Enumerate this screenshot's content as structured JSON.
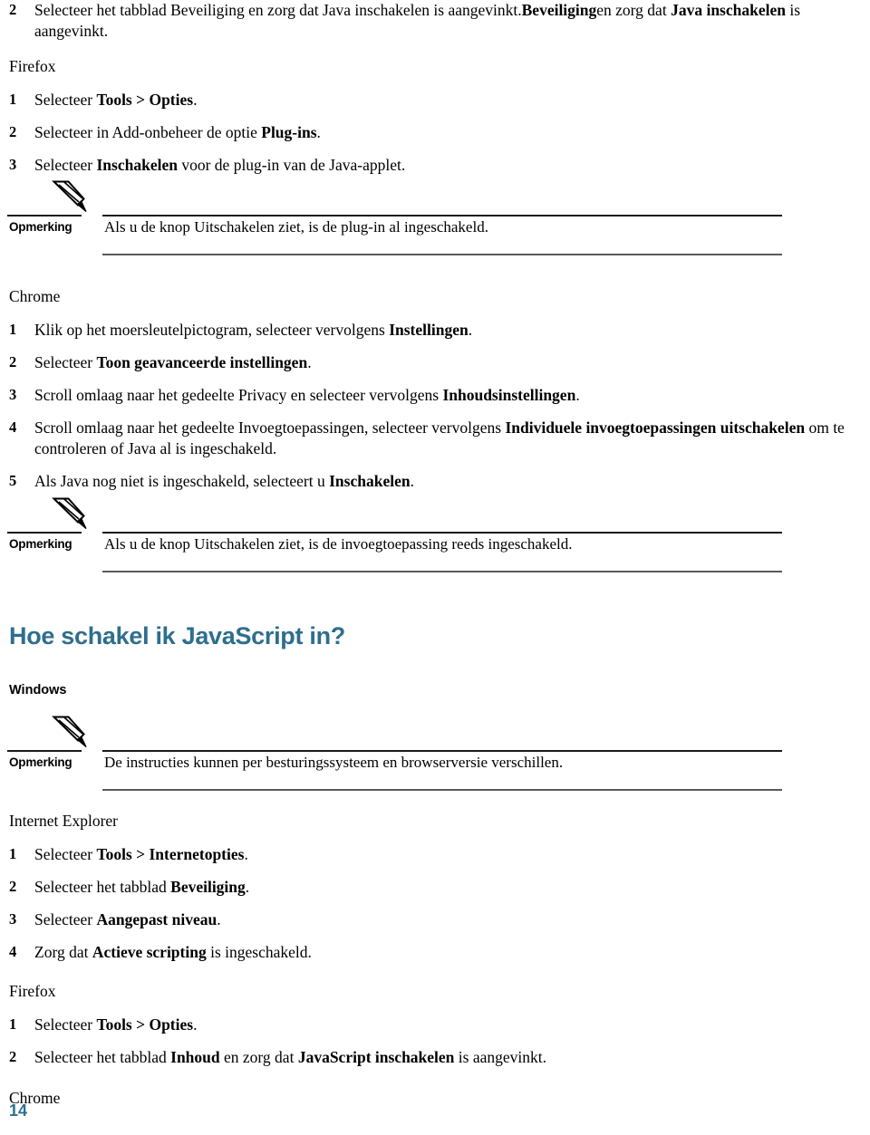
{
  "theme": {
    "accent_blue": "#2E6E8E",
    "rule_dark": "#1a1a1a",
    "rule_gray": "#595959",
    "text": "#000000"
  },
  "top_step": {
    "number": "2",
    "text_plain_1": "Selecteer het tabblad Beveiliging en zorg dat Java inschakelen is aangevinkt.",
    "text_bold_1": "Beveiliging",
    "text_plain_2": "en zorg dat ",
    "text_bold_2": "Java inschakelen",
    "text_plain_3": " is aangevinkt."
  },
  "sections": {
    "firefox_java": {
      "heading": "Firefox",
      "steps": [
        {
          "number": "1",
          "plain_1": "Selecteer ",
          "bold": "Tools > Opties",
          "plain_2": "."
        },
        {
          "number": "2",
          "plain_1": "Selecteer in Add-onbeheer de optie ",
          "bold": "Plug-ins",
          "plain_2": "."
        },
        {
          "number": "3",
          "plain_1": "Selecteer ",
          "bold": "Inschakelen",
          "plain_2": " voor de plug-in van de Java-applet."
        }
      ]
    },
    "chrome_java": {
      "heading": "Chrome",
      "steps": [
        {
          "number": "1",
          "plain_1": "Klik op het moersleutelpictogram, selecteer vervolgens ",
          "bold": "Instellingen",
          "plain_2": "."
        },
        {
          "number": "2",
          "plain_1": "Selecteer ",
          "bold": "Toon geavanceerde instellingen",
          "plain_2": "."
        },
        {
          "number": "3",
          "plain_1": "Scroll omlaag naar het gedeelte Privacy en selecteer vervolgens ",
          "bold": "Inhoudsinstellingen",
          "plain_2": "."
        },
        {
          "number": "4",
          "plain_1": "Scroll omlaag naar het gedeelte Invoegtoepassingen, selecteer vervolgens ",
          "bold": "Individuele invoegtoepassingen uitschakelen",
          "plain_2": " om te controleren of Java al is ingeschakeld."
        },
        {
          "number": "5",
          "plain_1": "Als Java nog niet is ingeschakeld, selecteert u ",
          "bold": "Inschakelen",
          "plain_2": "."
        }
      ]
    },
    "javascript": {
      "title": "Hoe schakel ik JavaScript in?",
      "os_heading": "Windows",
      "internet_explorer": {
        "heading": "Internet Explorer",
        "steps": [
          {
            "number": "1",
            "plain_1": "Selecteer ",
            "bold": "Tools > Internetopties",
            "plain_2": "."
          },
          {
            "number": "2",
            "plain_1": "Selecteer het tabblad ",
            "bold": "Beveiliging",
            "plain_2": "."
          },
          {
            "number": "3",
            "plain_1": "Selecteer ",
            "bold": "Aangepast niveau",
            "plain_2": "."
          },
          {
            "number": "4",
            "plain_1": "Zorg dat ",
            "bold": "Actieve scripting",
            "plain_2": " is ingeschakeld."
          }
        ]
      },
      "firefox": {
        "heading": "Firefox",
        "steps": [
          {
            "number": "1",
            "plain_1": "Selecteer ",
            "bold": "Tools > Opties",
            "plain_2": "."
          },
          {
            "number": "2",
            "plain_1": "Selecteer het tabblad ",
            "bold": "Inhoud",
            "plain_2": " en zorg dat ",
            "bold_2": "JavaScript inschakelen",
            "plain_3": " is aangevinkt."
          }
        ]
      },
      "chrome_heading": "Chrome"
    }
  },
  "notes": [
    {
      "label": "Opmerking",
      "text": "Als u de knop Uitschakelen ziet, is de plug-in al ingeschakeld.",
      "icon": "pencil-icon"
    },
    {
      "label": "Opmerking",
      "text": "Als u de knop Uitschakelen ziet, is de invoegtoepassing reeds ingeschakeld.",
      "icon": "pencil-icon"
    },
    {
      "label": "Opmerking",
      "text": "De instructies kunnen per besturingssysteem en browserversie verschillen.",
      "icon": "pencil-icon"
    }
  ],
  "footer": {
    "page_number": "14"
  }
}
